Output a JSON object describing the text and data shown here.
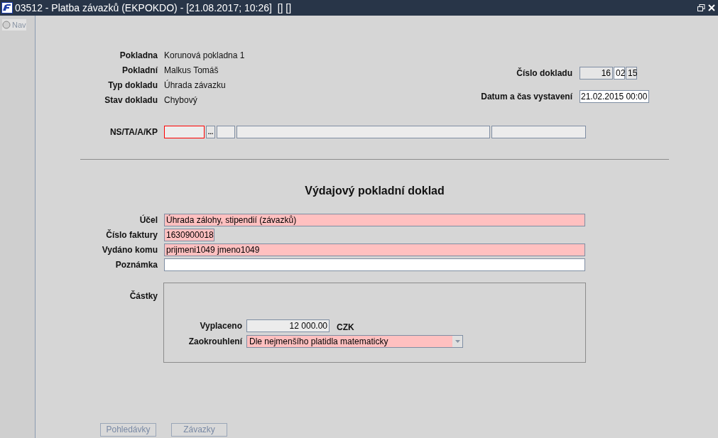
{
  "window": {
    "title": "03512 - Platba závazků (EKPOKDO) - [21.08.2017; 10:26]  [] []"
  },
  "sidebar": {
    "nav": {
      "label": "Nav",
      "selected": false
    }
  },
  "info": [
    {
      "label": "Pokladna",
      "value": "Korunová pokladna 1"
    },
    {
      "label": "Pokladní",
      "value": "Malkus Tomáš"
    },
    {
      "label": "Typ dokladu",
      "value": "Úhrada závazku"
    },
    {
      "label": "Stav dokladu",
      "value": "Chybový"
    }
  ],
  "document_number": {
    "label": "Číslo dokladu",
    "parts": [
      {
        "value": "16",
        "readonly": true
      },
      {
        "value": "02",
        "readonly": false
      },
      {
        "value": "15",
        "readonly": true
      }
    ]
  },
  "issue_date": {
    "label": "Datum a čas vystavení",
    "value": "21.02.2015 00:00"
  },
  "ns_row": {
    "label": "NS/TA/A/KP",
    "items": [
      {
        "kind": "input",
        "invalid": true,
        "readonly": true
      },
      {
        "kind": "button",
        "label": "..."
      },
      {
        "kind": "input",
        "invalid": false,
        "readonly": true
      },
      {
        "kind": "input",
        "invalid": false,
        "readonly": true
      },
      {
        "kind": "input",
        "invalid": false,
        "readonly": true
      }
    ]
  },
  "heading": "Výdajový pokladní doklad",
  "fields": [
    {
      "label": "Účel",
      "value": "Úhrada zálohy, stipendií  (závazků)",
      "required": true,
      "kind": "full"
    },
    {
      "label": "Číslo faktury",
      "value": "1630900018",
      "required": true,
      "kind": "short"
    },
    {
      "label": "Vydáno komu",
      "value": "prijmeni1049 jmeno1049",
      "required": true,
      "kind": "full"
    },
    {
      "label": "Poznámka",
      "required": false,
      "kind": "full"
    }
  ],
  "amounts": {
    "label": "Částky",
    "paid": {
      "label": "Vyplaceno",
      "value": "12 000.00",
      "currency": "CZK"
    },
    "rounding": {
      "label": "Zaokrouhlení",
      "value": "Dle nejmenšího platidla matematicky",
      "required": true
    }
  },
  "buttons": [
    {
      "label": "Pohledávky",
      "disabled": true
    },
    {
      "label": "Závazky",
      "disabled": true
    }
  ]
}
